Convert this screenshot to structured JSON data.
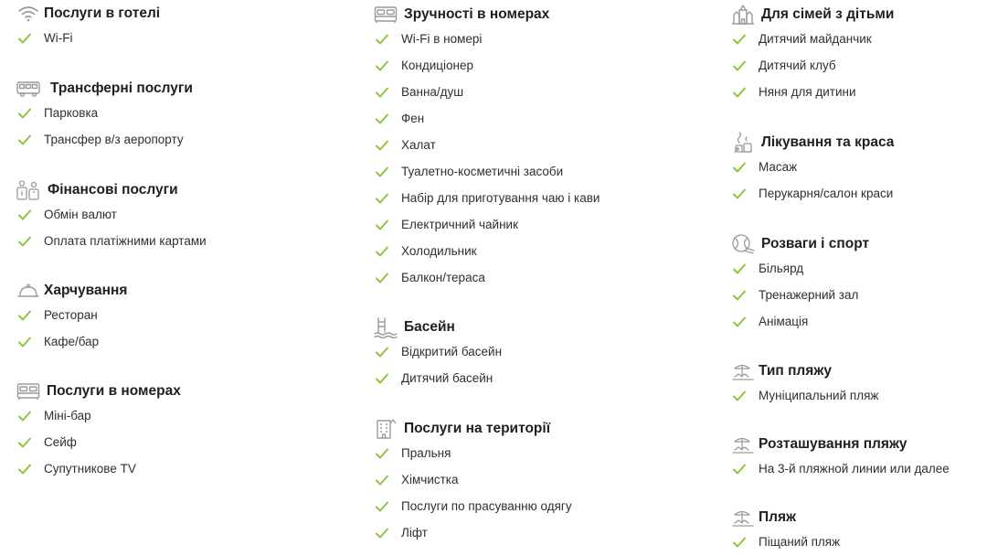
{
  "colors": {
    "check": "#8cc63f",
    "icon": "#9a9a9a",
    "title": "#1f1f1f",
    "text": "#2f2f2f"
  },
  "sections": [
    {
      "icon": "wifi-icon",
      "title": "Послуги в готелі",
      "items": [
        "Wi-Fi"
      ]
    },
    {
      "icon": "bus-icon",
      "title": "Трансферні послуги",
      "items": [
        "Парковка",
        "Трансфер в/з аеропорту"
      ]
    },
    {
      "icon": "money-icon",
      "title": "Фінансові послуги",
      "items": [
        "Обмін валют",
        "Оплата платіжними картами"
      ]
    },
    {
      "icon": "cloche-icon",
      "title": "Харчування",
      "items": [
        "Ресторан",
        "Кафе/бар"
      ]
    },
    {
      "icon": "bed-icon",
      "title": "Послуги в номерах",
      "items": [
        "Міні-бар",
        "Сейф",
        "Супутникове TV"
      ]
    },
    {
      "icon": "bed-icon",
      "title": "Зручності в номерах",
      "items": [
        "Wi-Fi в номері",
        "Кондиціонер",
        "Ванна/душ",
        "Фен",
        "Халат",
        "Туалетно-косметичні засоби",
        "Набір для приготування чаю і кави",
        "Електричний чайник",
        "Холодильник",
        "Балкон/тераса"
      ]
    },
    {
      "icon": "pool-icon",
      "title": "Басейн",
      "items": [
        "Відкритий басейн",
        "Дитячий басейн"
      ]
    },
    {
      "icon": "building-icon",
      "title": "Послуги на території",
      "items": [
        "Пральня",
        "Хімчистка",
        "Послуги по прасуванню одягу",
        "Ліфт"
      ]
    },
    {
      "icon": "castle-icon",
      "title": "Для сімей з дітьми",
      "items": [
        "Дитячий майданчик",
        "Дитячий клуб",
        "Няня для дитини"
      ]
    },
    {
      "icon": "spa-icon",
      "title": "Лікування та краса",
      "items": [
        "Масаж",
        "Перукарня/салон краси"
      ]
    },
    {
      "icon": "tennis-ball-icon",
      "title": "Розваги і спорт",
      "items": [
        "Більярд",
        "Тренажерний зал",
        "Анімація"
      ]
    },
    {
      "icon": "beach-icon",
      "title": "Тип пляжу",
      "items": [
        "Муніципальний пляж"
      ]
    },
    {
      "icon": "beach-icon",
      "title": "Розташування пляжу",
      "items": [
        "На 3-й пляжной линии или далее"
      ]
    },
    {
      "icon": "beach-icon",
      "title": "Пляж",
      "items": [
        "Піщаний пляж"
      ]
    }
  ]
}
